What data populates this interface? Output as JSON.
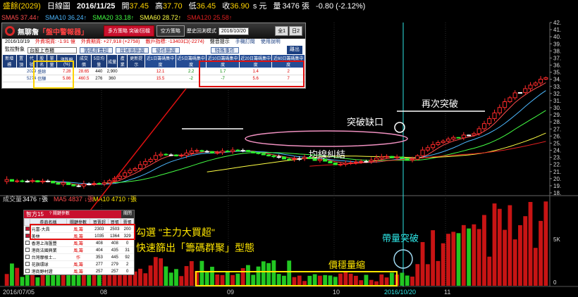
{
  "header": {
    "symbol": "盛餘(2029)",
    "period": "日線圖",
    "date": "2016/11/25",
    "open_label": "開",
    "open": "37.45",
    "high_label": "高",
    "high": "37.70",
    "low_label": "低",
    "low": "36.45",
    "close_label": "收",
    "close": "36.90",
    "unit": "s 元",
    "volume_label": "量",
    "volume": "3476 張",
    "change": "-0.80 (-2.12%)"
  },
  "ma_bar": [
    {
      "label": "SMA5",
      "value": "37.44↑",
      "color": "#ff4d4d"
    },
    {
      "label": "SMA10",
      "value": "36.24↑",
      "color": "#4db8ff"
    },
    {
      "label": "SMA20",
      "value": "33.18↑",
      "color": "#44ff44"
    },
    {
      "label": "SMA60",
      "value": "28.72↑",
      "color": "#ffff44"
    },
    {
      "label": "SMA120",
      "value": "25.58↑",
      "color": "#e02020"
    }
  ],
  "price_axis": [
    "42.",
    "41.",
    "40.",
    "39.",
    "38.",
    "37.",
    "36.",
    "35.",
    "34.",
    "33.",
    "32.",
    "31.",
    "30.",
    "29.",
    "28.",
    "27.",
    "26.",
    "25.",
    "24.",
    "23.",
    "22.",
    "21.",
    "20.",
    "19.",
    "18."
  ],
  "volume_axis": [
    "5K",
    "0"
  ],
  "date_axis": [
    {
      "label": "2016/07/05",
      "color": "#ccc"
    },
    {
      "label": "08",
      "color": "#ccc"
    },
    {
      "label": "09",
      "color": "#ccc"
    },
    {
      "label": "10",
      "color": "#ccc"
    },
    {
      "label": "2016/10/20",
      "color": "#2ee6e6"
    },
    {
      "label": "11",
      "color": "#ccc"
    }
  ],
  "volume_legend": {
    "title": "成交量",
    "vol_value": "3476 ↑張",
    "ma5_label": "MA5",
    "ma5_value": "4837 ↓張",
    "ma10_label": "MA10",
    "ma10_value": "4710 ↑張"
  },
  "panel": {
    "logo_text_a": "無聊詹",
    "logo_text_b": "「盤中警報器」",
    "strategy_btn": "多方策略  突破/回檔",
    "short_btn": "空方策略",
    "history_label": "歷史回測模式",
    "date_value": "2016/10/20",
    "side_btns": [
      "全1",
      "日2"
    ],
    "row2": [
      "2016/10/19",
      "外資現貨: -1.91 億",
      "外資期貨: +27,918 (+2758)",
      "散戶指標: -13403口(-2274)",
      "聲音提示",
      "手機訂閱",
      "使用說明"
    ],
    "monitor_label": "監控對象",
    "market": "台股上市櫃",
    "tab_buttons": [
      "籌碼買賣超",
      "技術面篩選",
      "條件篩選",
      "特殊事件"
    ],
    "exit_btn": "離出",
    "columns": [
      "新增標",
      "置頂",
      "代號",
      "股名",
      "單量",
      "漲跌幅(%)",
      "成交價",
      "5日均量",
      "成量",
      "產業",
      "更新提示",
      "近1日籌碼集中度",
      "近5日籌碼集中度",
      "近10日籌碼集中度",
      "近20日籌碼集中度",
      "近60日籌碼集中度"
    ],
    "rows": [
      {
        "code": "2029",
        "name": "盛餘",
        "chg": "7.28",
        "price": "28.65",
        "avg5": "440",
        "vol": "2,900",
        "c1": "12.1",
        "c5": "2.2",
        "c10": "1.7",
        "c20": "1.4",
        "c60": "2"
      },
      {
        "code": "5274",
        "name": "信驊",
        "chg": "5.86",
        "price": "460.5",
        "avg5": "276",
        "vol": "360",
        "c1": "15.5",
        "c5": "-2",
        "c10": "-7",
        "c20": "5.6",
        "c60": "7"
      }
    ]
  },
  "filter": {
    "title": "智方15",
    "hint": "? 關鍵參數",
    "close": "關閉",
    "columns": [
      "",
      "券商名稱",
      "關鍵參數",
      "買賣超",
      "買張",
      "賣張"
    ],
    "rows": [
      {
        "name": "元富-大昌",
        "type": "風,籌",
        "net": "2303",
        "buy": "2503",
        "sell": "200",
        "checked": true
      },
      {
        "name": "美林",
        "type": "風,籌",
        "net": "1035",
        "buy": "1364",
        "sell": "329",
        "checked": true
      },
      {
        "name": "香港上海匯豐",
        "type": "風,籌",
        "net": "408",
        "buy": "408",
        "sell": "0",
        "checked": false
      },
      {
        "name": "港商法國興業",
        "type": "風,籌",
        "net": "404",
        "buy": "435",
        "sell": "31",
        "checked": false
      },
      {
        "name": "台灣摩根士...",
        "type": "作",
        "net": "353",
        "buy": "445",
        "sell": "92",
        "checked": false
      },
      {
        "name": "花旗環球",
        "type": "風,籌",
        "net": "277",
        "buy": "279",
        "sell": "2",
        "checked": false
      },
      {
        "name": "港商野村證",
        "type": "風,籌",
        "net": "257",
        "buy": "257",
        "sell": "0",
        "checked": false
      }
    ]
  },
  "annotations": {
    "break_gap": "突破缺口",
    "rebreak": "再次突破",
    "ma_tangle": "均線糾結",
    "vol_break": "帶量突破",
    "vol_shrink": "價穩量縮",
    "filter_line1": "勾選 \"主力大買超\"",
    "filter_line2": "快速篩出「籌碼群聚」型態"
  },
  "colors": {
    "up": "#ff2a2a",
    "down": "#2eef2e",
    "flat": "#ffffff",
    "accent_cyan": "#2ee6e6",
    "accent_yellow": "#ffe600"
  }
}
